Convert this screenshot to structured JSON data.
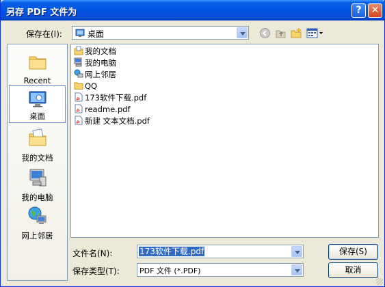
{
  "window": {
    "title": "另存 PDF 文件为"
  },
  "titlebar": {
    "help_glyph": "?",
    "close_glyph": "✕"
  },
  "save_in": {
    "label": "保存在(I):",
    "value": "桌面"
  },
  "places": [
    {
      "label": "Recent"
    },
    {
      "label": "桌面"
    },
    {
      "label": "我的文档"
    },
    {
      "label": "我的电脑"
    },
    {
      "label": "网上邻居"
    }
  ],
  "files": [
    {
      "name": "我的文档",
      "icon": "my-documents-icon"
    },
    {
      "name": "我的电脑",
      "icon": "my-computer-icon"
    },
    {
      "name": "网上邻居",
      "icon": "network-icon"
    },
    {
      "name": "QQ",
      "icon": "folder-icon"
    },
    {
      "name": "173软件下载.pdf",
      "icon": "pdf-file-icon"
    },
    {
      "name": "readme.pdf",
      "icon": "pdf-file-icon"
    },
    {
      "name": "新建 文本文档.pdf",
      "icon": "pdf-file-icon"
    }
  ],
  "filename": {
    "label": "文件名(N):",
    "value": "173软件下载.pdf"
  },
  "filetype": {
    "label": "保存类型(T):",
    "value": "PDF 文件 (*.PDF)"
  },
  "buttons": {
    "save": "保存(S)",
    "cancel": "取消"
  },
  "colors": {
    "titlebar": "#0054e3",
    "dialog_bg": "#ece9d8",
    "selection": "#316ac5"
  }
}
